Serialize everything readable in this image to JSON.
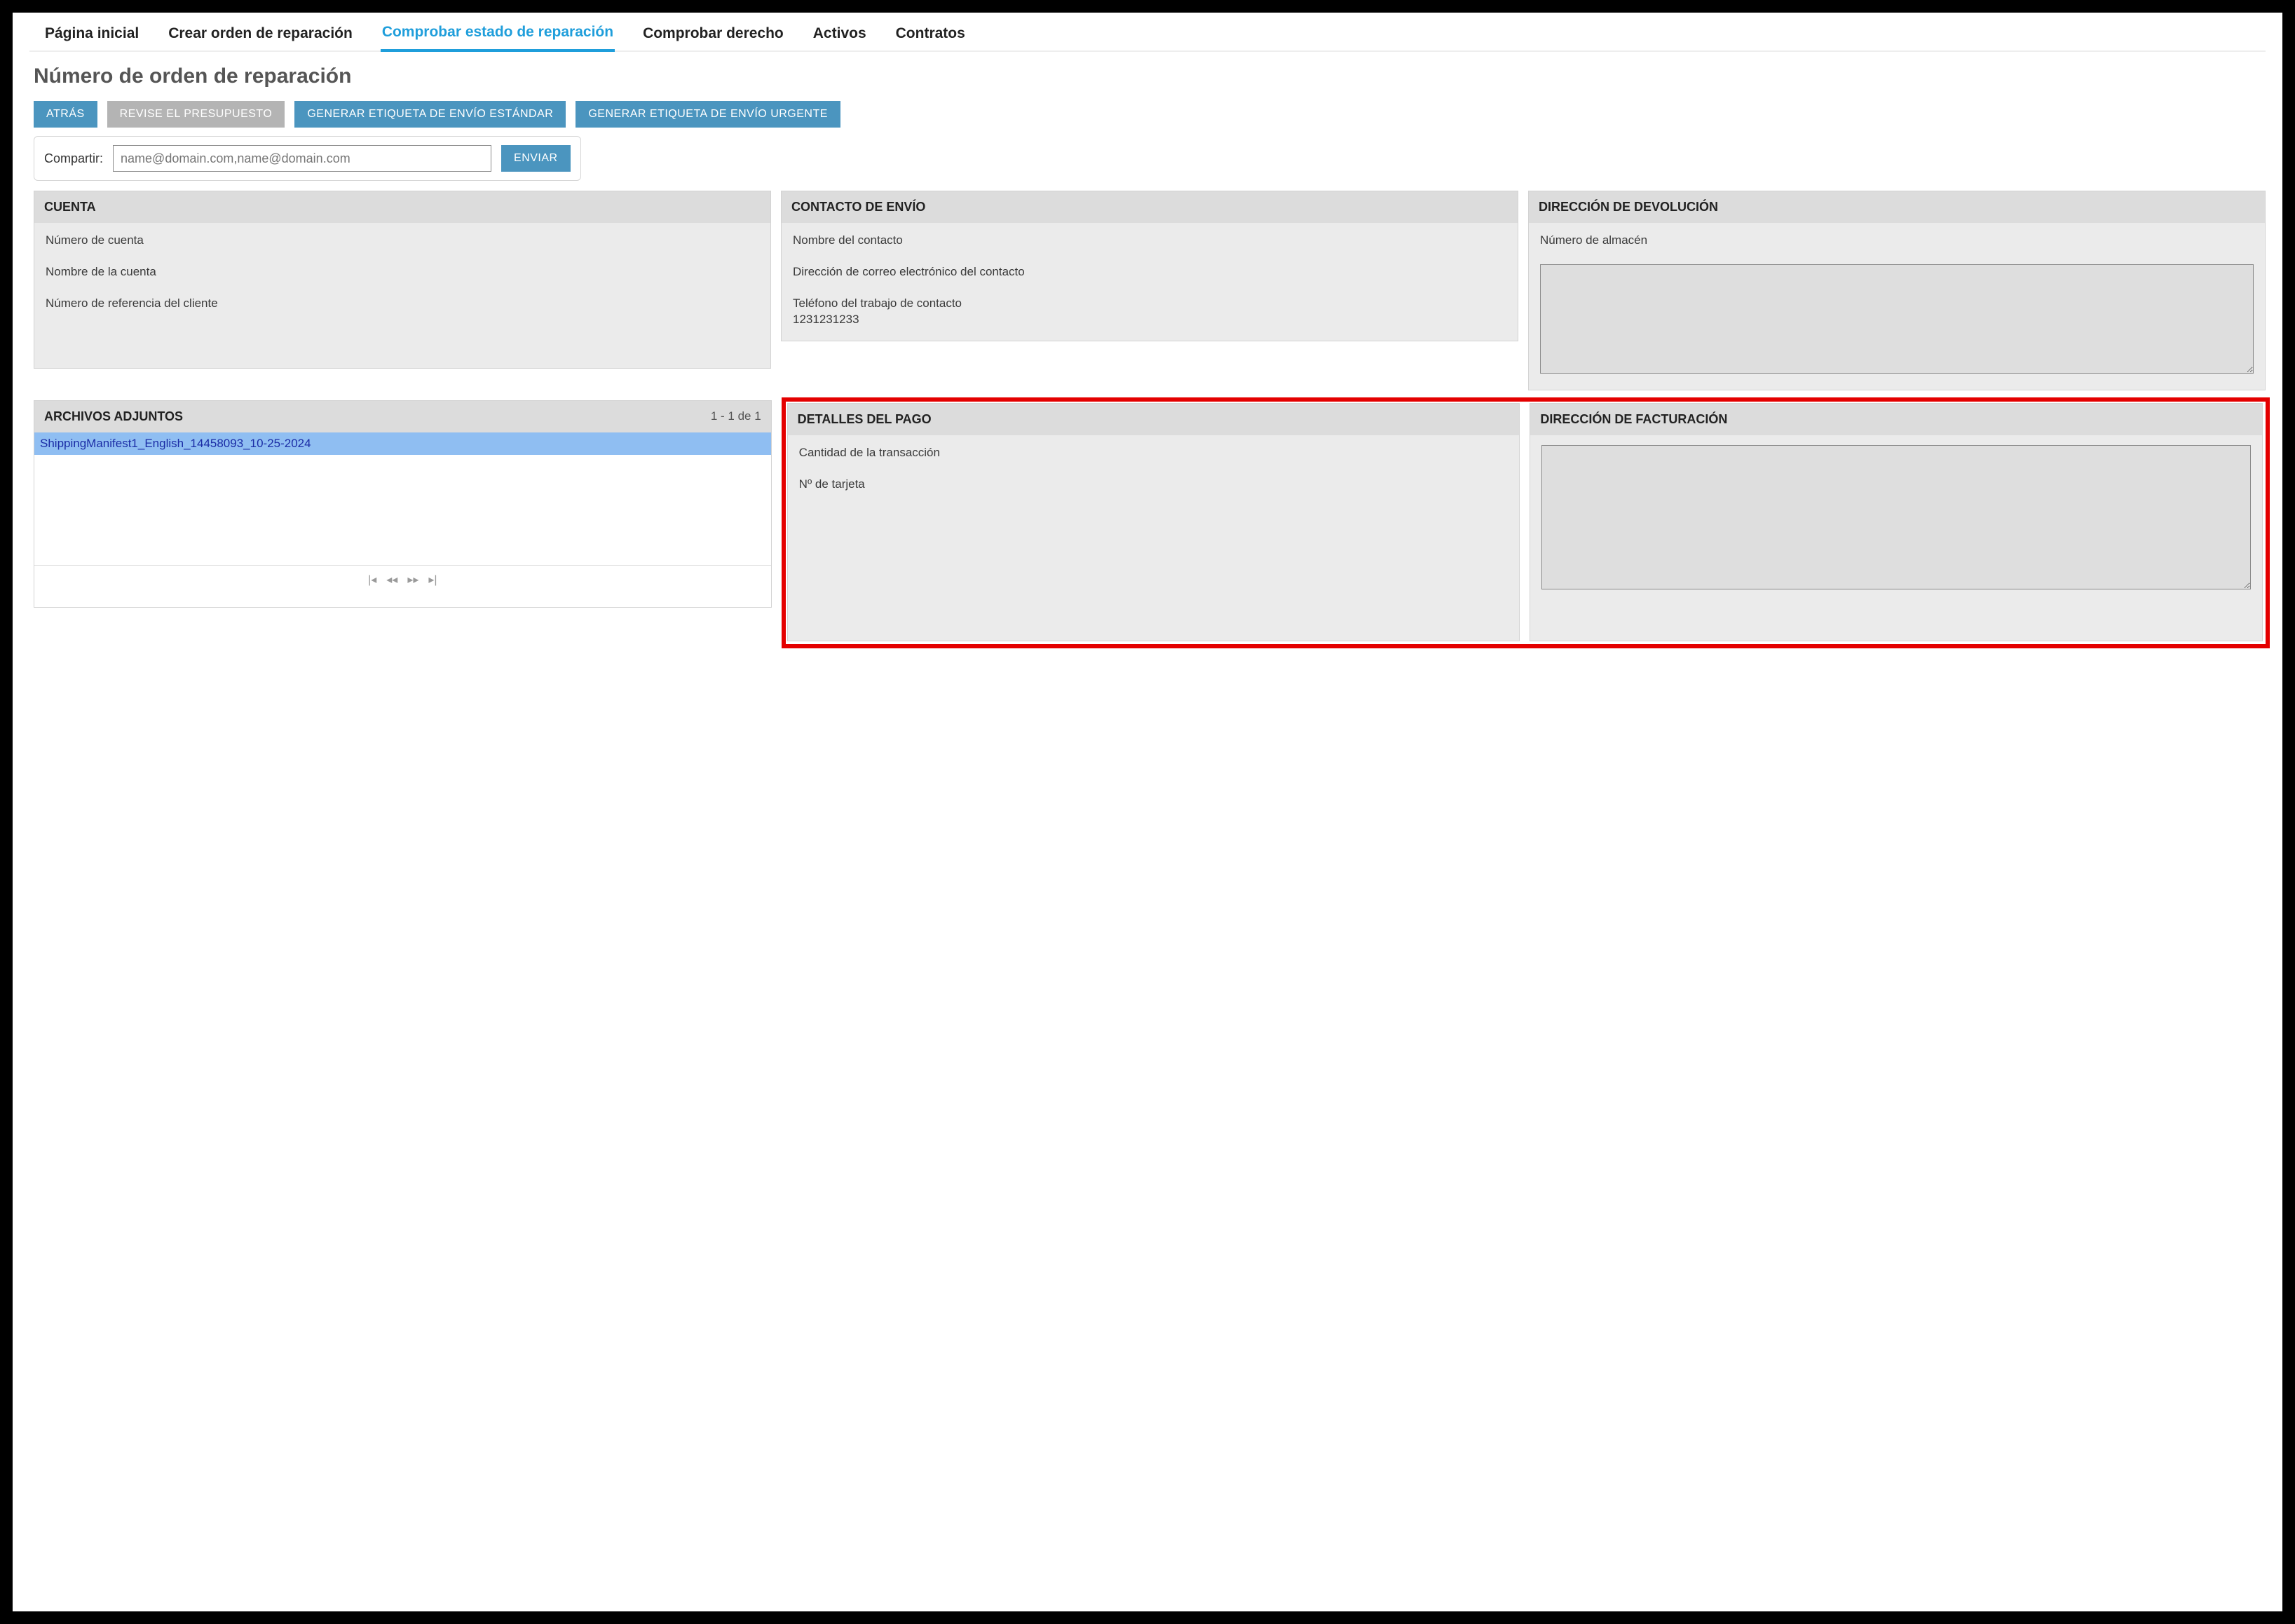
{
  "tabs": {
    "home": "Página inicial",
    "create": "Crear orden de reparación",
    "status": "Comprobar estado de reparación",
    "entitlement": "Comprobar derecho",
    "assets": "Activos",
    "contracts": "Contratos"
  },
  "page_title": "Número de orden de reparación",
  "buttons": {
    "back": "ATRÁS",
    "review_quote": "REVISE EL PRESUPUESTO",
    "gen_std_label": "GENERAR ETIQUETA DE ENVÍO ESTÁNDAR",
    "gen_urgent_label": "GENERAR ETIQUETA DE ENVÍO URGENTE",
    "send": "ENVIAR"
  },
  "share": {
    "label": "Compartir:",
    "placeholder": "name@domain.com,name@domain.com"
  },
  "panels": {
    "account": {
      "title": "CUENTA",
      "account_number_label": "Número de cuenta",
      "account_name_label": "Nombre de la cuenta",
      "customer_ref_label": "Número de referencia del cliente"
    },
    "ship_contact": {
      "title": "CONTACTO DE ENVÍO",
      "name_label": "Nombre del contacto",
      "email_label": "Dirección de correo electrónico del contacto",
      "phone_label": "Teléfono del trabajo de contacto",
      "phone_value": "1231231233"
    },
    "return_addr": {
      "title": "DIRECCIÓN DE DEVOLUCIÓN",
      "store_number_label": "Número de almacén"
    },
    "attachments": {
      "title": "ARCHIVOS ADJUNTOS",
      "count": "1 - 1 de 1",
      "item": "ShippingManifest1_English_14458093_10-25-2024"
    },
    "payment": {
      "title": "DETALLES DEL PAGO",
      "amount_label": "Cantidad de la transacción",
      "card_label": "Nº de tarjeta"
    },
    "billing": {
      "title": "DIRECCIÓN DE FACTURACIÓN"
    }
  },
  "pager": {
    "first": "⏮",
    "prev": "◀◀",
    "next": "▶▶",
    "last": "⏭"
  }
}
